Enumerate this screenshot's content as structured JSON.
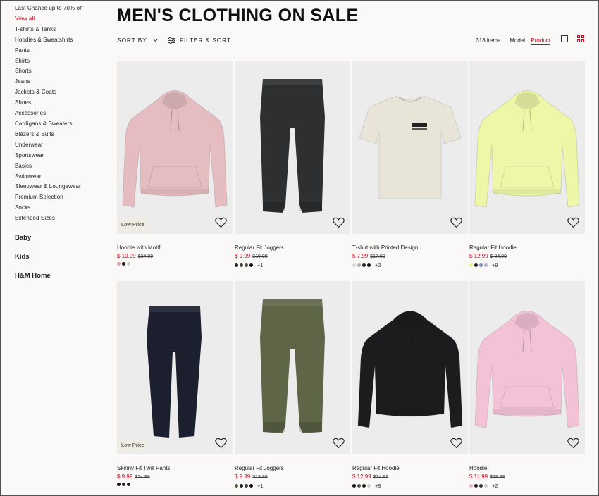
{
  "sidebar": {
    "links": [
      "Last Chance up to 70% off",
      "View all",
      "T-shirts & Tanks",
      "Hoodies & Sweatshirts",
      "Pants",
      "Shirts",
      "Shorts",
      "Jeans",
      "Jackets & Coats",
      "Shoes",
      "Accessories",
      "Cardigans & Sweaters",
      "Blazers & Suits",
      "Underwear",
      "Sportswear",
      "Basics",
      "Swimwear",
      "Sleepwear & Loungewear",
      "Premium Selection",
      "Socks",
      "Extended Sizes"
    ],
    "active_index": 1,
    "sections": [
      "Baby",
      "Kids",
      "H&M Home"
    ]
  },
  "header": {
    "title": "MEN'S CLOTHING ON SALE",
    "sort_label": "SORT BY",
    "filter_label": "FILTER & SORT",
    "item_count": "318 items",
    "view_model": "Model",
    "view_product": "Product"
  },
  "colors": {
    "accent": "#d0021b"
  },
  "products": [
    {
      "name": "Hoodie with Motif",
      "price": "$ 10.99",
      "old_price": "$24.99",
      "badge": "Low Price",
      "swatches": [
        "#d7a4ae",
        "#222222",
        "#cfcfcf"
      ],
      "more": "",
      "kind": "hoodie",
      "color": "#e5bcc0"
    },
    {
      "name": "Regular Fit Joggers",
      "price": "$ 9.99",
      "old_price": "$19.99",
      "badge": "",
      "swatches": [
        "#222222",
        "#444444",
        "#555a4a",
        "#111111"
      ],
      "more": "+1",
      "kind": "pants",
      "color": "#2e2f31"
    },
    {
      "name": "T-shirt with Printed Design",
      "price": "$ 7.99",
      "old_price": "$17.99",
      "badge": "",
      "swatches": [
        "#d9d6cc",
        "#aaaaaa",
        "#222222",
        "#111111"
      ],
      "more": "+2",
      "kind": "tshirt",
      "color": "#e8e4d8"
    },
    {
      "name": "Regular Fit Hoodie",
      "price": "$ 12.99",
      "old_price": "$ 34.99",
      "badge": "",
      "swatches": [
        "#e6f58a",
        "#222222",
        "#7b8bb8",
        "#b8a6d9"
      ],
      "more": "+9",
      "kind": "hoodie",
      "color": "#eef7a8"
    },
    {
      "name": "Skinny Fit Twill Pants",
      "price": "$ 9.99",
      "old_price": "$24.99",
      "badge": "Low Price",
      "swatches": [
        "#111111",
        "#222222",
        "#1a1d2a"
      ],
      "more": "",
      "kind": "pants_slim",
      "color": "#1b1f2e"
    },
    {
      "name": "Regular Fit Joggers",
      "price": "$ 9.99",
      "old_price": "$19.99",
      "badge": "",
      "swatches": [
        "#5a6044",
        "#222222",
        "#444444",
        "#111111"
      ],
      "more": "+1",
      "kind": "pants",
      "color": "#5f6648"
    },
    {
      "name": "Regular Fit Hoodie",
      "price": "$ 12.99",
      "old_price": "$34.99",
      "badge": "",
      "swatches": [
        "#111111",
        "#555555",
        "#222222",
        "#cccccc"
      ],
      "more": "+9",
      "kind": "hoodie",
      "color": "#1c1c1e"
    },
    {
      "name": "Hoodie",
      "price": "$ 11.99",
      "old_price": "$29.99",
      "badge": "",
      "swatches": [
        "#e8b6cc",
        "#222222",
        "#333333",
        "#cccccc"
      ],
      "more": "+2",
      "kind": "hoodie",
      "color": "#f3c2d6"
    }
  ]
}
